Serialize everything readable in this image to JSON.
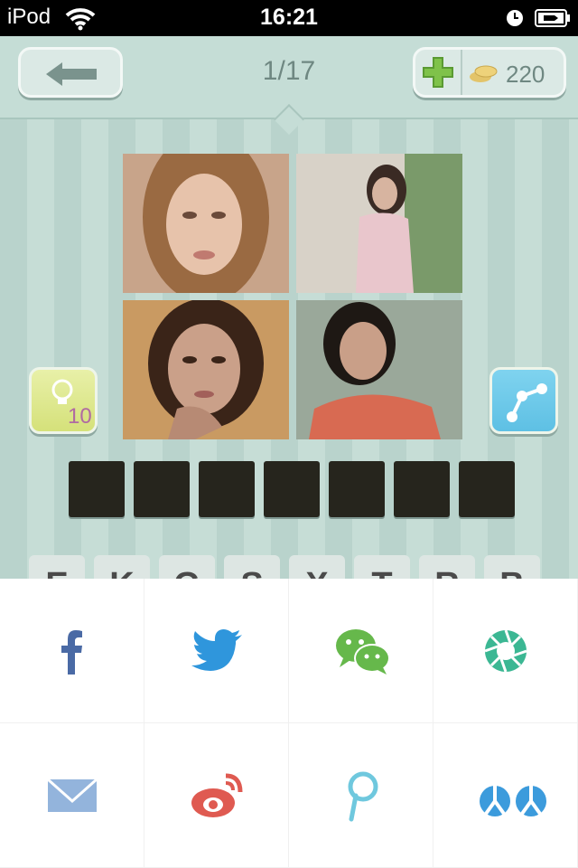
{
  "status_bar": {
    "carrier": "iPod",
    "time": "16:21"
  },
  "header": {
    "level": "1/17",
    "coins": "220"
  },
  "hint": {
    "cost": "10"
  },
  "answer": {
    "slot_count": 7
  },
  "keyboard": {
    "letters": [
      "E",
      "K",
      "G",
      "S",
      "X",
      "T",
      "R",
      "B"
    ]
  },
  "share_sheet": {
    "items": [
      {
        "icon": "facebook-icon",
        "color": "#4a6aa5"
      },
      {
        "icon": "twitter-icon",
        "color": "#2f96dc"
      },
      {
        "icon": "wechat-icon",
        "color": "#66b84b"
      },
      {
        "icon": "moments-icon",
        "color": "#3bb793"
      },
      {
        "icon": "mail-icon",
        "color": "#93b4dc"
      },
      {
        "icon": "weibo-icon",
        "color": "#df5a51"
      },
      {
        "icon": "pinterest-icon",
        "color": "#6fc8de"
      },
      {
        "icon": "renren-icon",
        "color": "#3c9bdc"
      }
    ]
  }
}
